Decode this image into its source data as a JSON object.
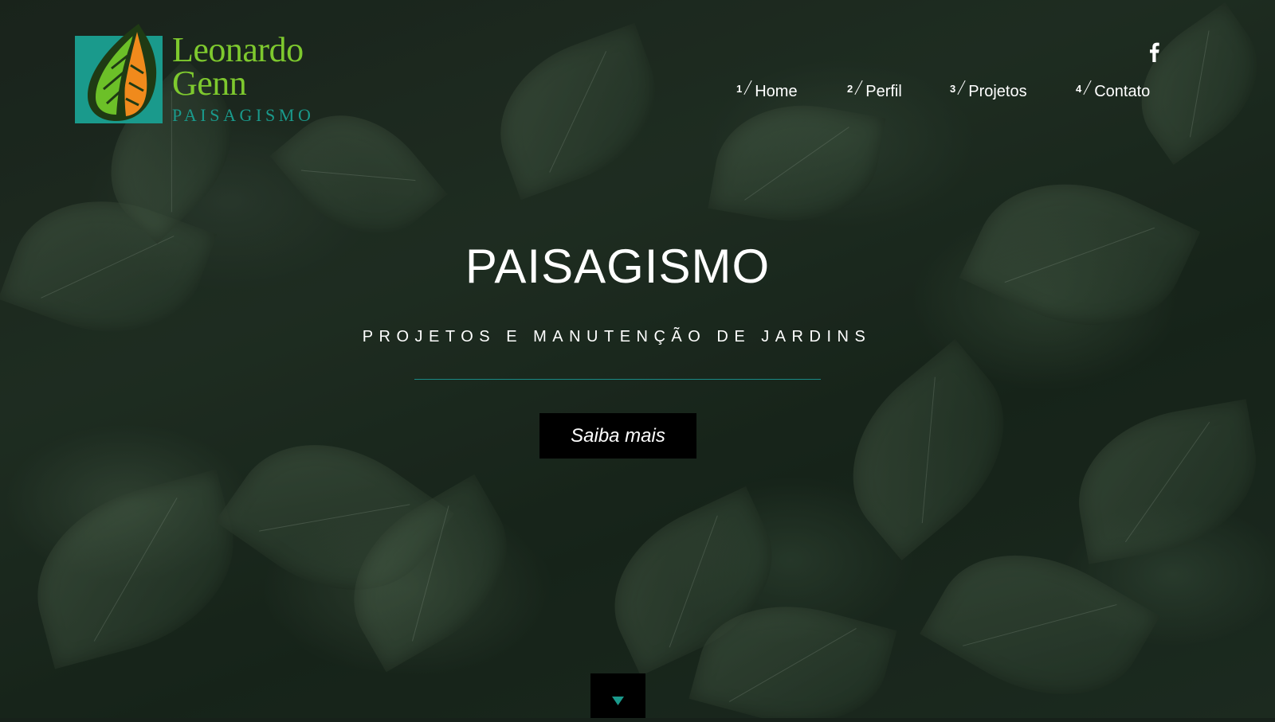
{
  "colors": {
    "logo_green": "#7ec92e",
    "logo_teal": "#1a9a8c",
    "accent_teal": "#1a8a86",
    "button_bg": "#000000",
    "text": "#ffffff"
  },
  "brand": {
    "line1": "Leonardo",
    "line2": "Genn",
    "line3": "PAISAGISMO"
  },
  "social": {
    "facebook_icon": "facebook-icon"
  },
  "nav": {
    "items": [
      {
        "number": "1",
        "label": "Home"
      },
      {
        "number": "2",
        "label": "Perfil"
      },
      {
        "number": "3",
        "label": "Projetos"
      },
      {
        "number": "4",
        "label": "Contato"
      }
    ]
  },
  "hero": {
    "title": "PAISAGISMO",
    "subtitle": "PROJETOS E MANUTENÇÃO DE JARDINS",
    "button_label": "Saiba mais",
    "scroll_icon": "chevron-down-icon"
  }
}
